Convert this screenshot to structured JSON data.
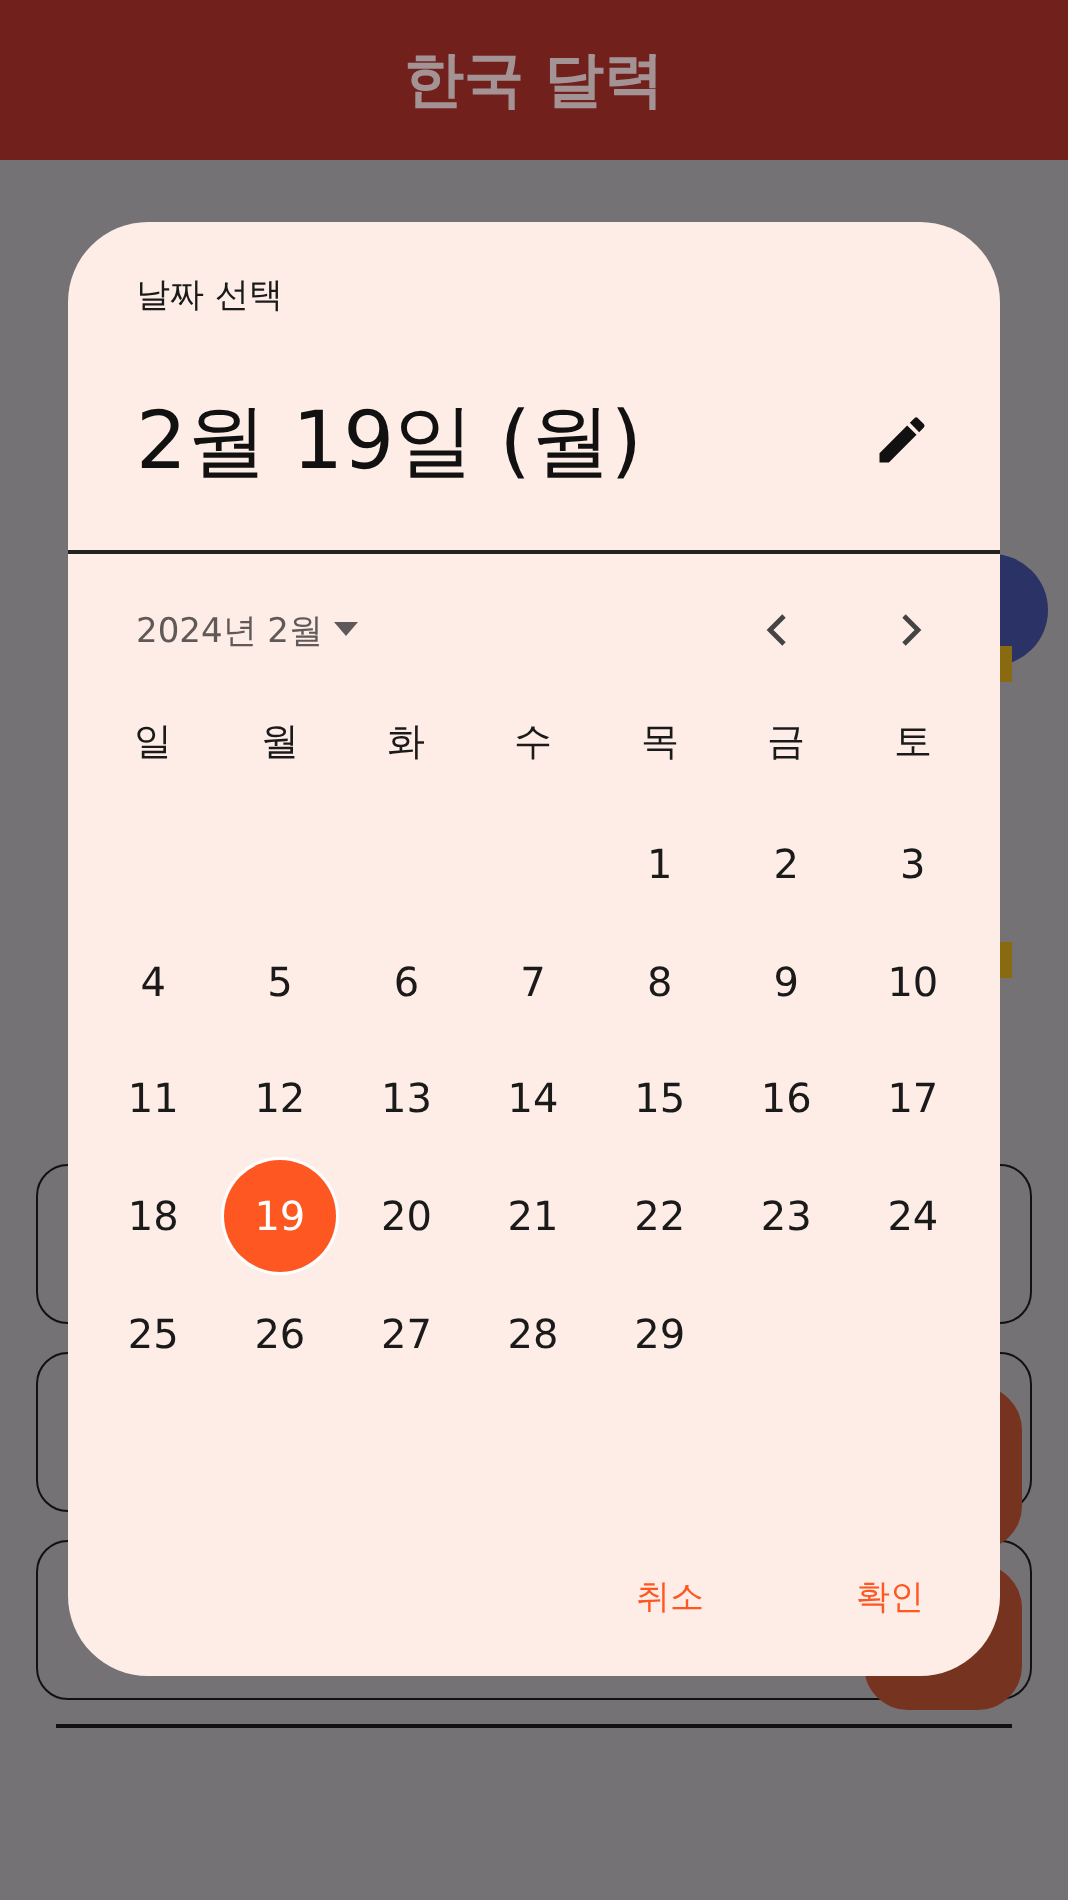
{
  "app_bar": {
    "title": "한국 달력"
  },
  "dialog": {
    "title": "날짜 선택",
    "headline": "2월 19일 (월)",
    "month_label": "2024년 2월",
    "weekdays": [
      "일",
      "월",
      "화",
      "수",
      "목",
      "금",
      "토"
    ],
    "weeks": [
      [
        {
          "label": "1",
          "selected": false
        },
        {
          "label": "2",
          "selected": false
        },
        {
          "label": "3",
          "selected": false
        }
      ],
      [
        {
          "label": "4",
          "selected": false
        },
        {
          "label": "5",
          "selected": false
        },
        {
          "label": "6",
          "selected": false
        },
        {
          "label": "7",
          "selected": false
        },
        {
          "label": "8",
          "selected": false
        },
        {
          "label": "9",
          "selected": false
        },
        {
          "label": "10",
          "selected": false
        }
      ],
      [
        {
          "label": "11",
          "selected": false
        },
        {
          "label": "12",
          "selected": false
        },
        {
          "label": "13",
          "selected": false
        },
        {
          "label": "14",
          "selected": false
        },
        {
          "label": "15",
          "selected": false
        },
        {
          "label": "16",
          "selected": false
        },
        {
          "label": "17",
          "selected": false
        }
      ],
      [
        {
          "label": "18",
          "selected": false
        },
        {
          "label": "19",
          "selected": true
        },
        {
          "label": "20",
          "selected": false
        },
        {
          "label": "21",
          "selected": false
        },
        {
          "label": "22",
          "selected": false
        },
        {
          "label": "23",
          "selected": false
        },
        {
          "label": "24",
          "selected": false
        }
      ],
      [
        {
          "label": "25",
          "selected": false
        },
        {
          "label": "26",
          "selected": false
        },
        {
          "label": "27",
          "selected": false
        },
        {
          "label": "28",
          "selected": false
        },
        {
          "label": "29",
          "selected": false
        }
      ]
    ],
    "actions": [
      "취소",
      "확인"
    ]
  }
}
